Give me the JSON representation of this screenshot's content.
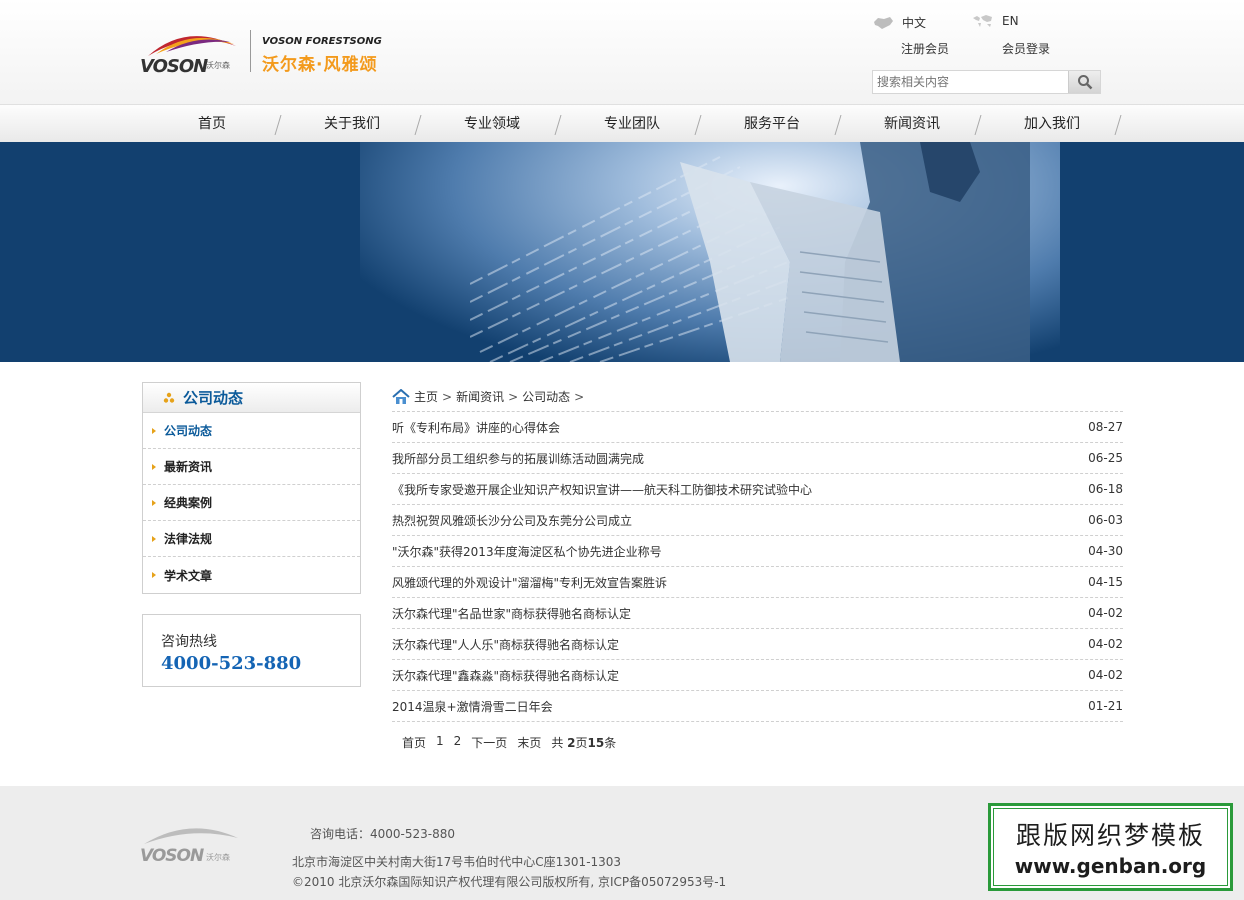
{
  "header": {
    "logo_brand": "VOSON",
    "logo_brand_small": "沃尔森",
    "logo_en": "VOSON FORESTSONG",
    "logo_cn": "沃尔森·风雅颂",
    "lang_cn": "中文",
    "lang_en": "EN",
    "register": "注册会员",
    "login": "会员登录",
    "search_placeholder": "搜索相关内容"
  },
  "nav": [
    "首页",
    "关于我们",
    "专业领域",
    "专业团队",
    "服务平台",
    "新闻资讯",
    "加入我们"
  ],
  "sidebar": {
    "title": "公司动态",
    "items": [
      "公司动态",
      "最新资讯",
      "经典案例",
      "法律法规",
      "学术文章"
    ],
    "hotline_label": "咨询热线",
    "hotline_number": "4000-523-880"
  },
  "breadcrumb": {
    "home": "主页",
    "sep": ">",
    "level1": "新闻资讯",
    "level2": "公司动态"
  },
  "news": [
    {
      "title": "听《专利布局》讲座的心得体会",
      "date": "08-27"
    },
    {
      "title": "我所部分员工组织参与的拓展训练活动圆满完成",
      "date": "06-25"
    },
    {
      "title": "《我所专家受邀开展企业知识产权知识宣讲——航天科工防御技术研究试验中心",
      "date": "06-18"
    },
    {
      "title": "热烈祝贺风雅颂长沙分公司及东莞分公司成立",
      "date": "06-03"
    },
    {
      "title": "\"沃尔森\"获得2013年度海淀区私个协先进企业称号",
      "date": "04-30"
    },
    {
      "title": "风雅颂代理的外观设计\"溜溜梅\"专利无效宣告案胜诉",
      "date": "04-15"
    },
    {
      "title": "沃尔森代理\"名品世家\"商标获得驰名商标认定",
      "date": "04-02"
    },
    {
      "title": "沃尔森代理\"人人乐\"商标获得驰名商标认定",
      "date": "04-02"
    },
    {
      "title": "沃尔森代理\"鑫森淼\"商标获得驰名商标认定",
      "date": "04-02"
    },
    {
      "title": "2014温泉+激情滑雪二日年会",
      "date": "01-21"
    }
  ],
  "pager": {
    "first": "首页",
    "p1": "1",
    "p2": "2",
    "next": "下一页",
    "last": "末页",
    "total_prefix": "共",
    "total_pages": "2",
    "pages_unit": "页",
    "total_items": "15",
    "items_unit": "条"
  },
  "footer": {
    "logo_brand": "VOSON",
    "logo_brand_small": "沃尔森",
    "phone": "咨询电话：4000-523-880",
    "address": "北京市海淀区中关村南大街17号韦伯时代中心C座1301-1303",
    "copyright": "©2010 北京沃尔森国际知识产权代理有限公司版权所有, 京ICP备05072953号-1"
  },
  "watermark": {
    "line1": "跟版网织梦模板",
    "line2": "www.genban.org"
  },
  "colors": {
    "accent_blue": "#0b5a9a",
    "hotline_blue": "#1464b4",
    "logo_orange": "#f39a1c",
    "banner_blue": "#12406f"
  }
}
